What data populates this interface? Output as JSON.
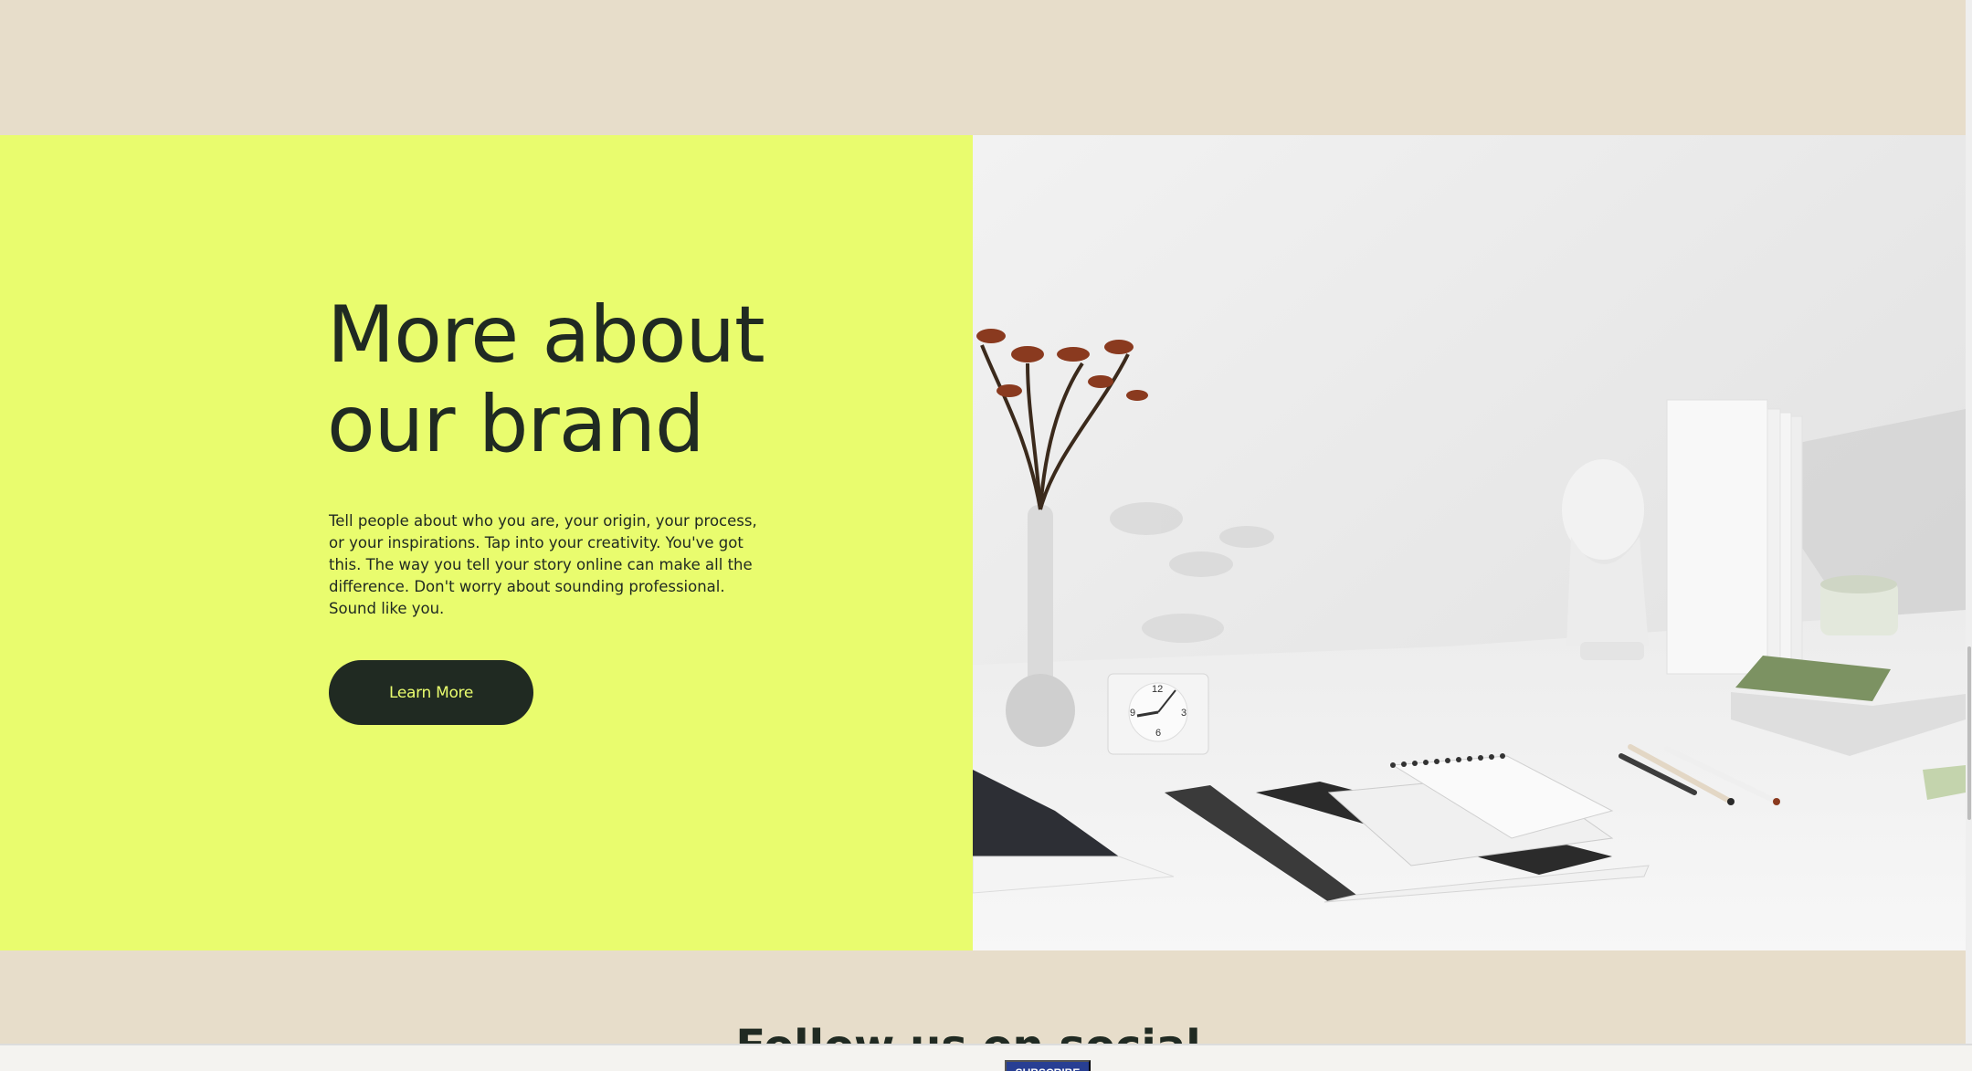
{
  "brand": {
    "heading": "More about our brand",
    "body": "Tell people about who you are, your origin, your process, or your inspirations. Tap into your creativity. You've got this. The way you tell your story online can make all the difference. Don't worry about sounding professional. Sound like you.",
    "button_label": "Learn More",
    "image_icon": "desk-still-life-photo"
  },
  "social": {
    "heading": "Follow us on social"
  },
  "bottom_bar": {
    "subscribe_label": "SUBSCRIBE"
  },
  "colors": {
    "page_background": "#e7ddca",
    "brand_panel": "#e9fc6e",
    "text_dark": "#202a22",
    "button_background": "#202a22",
    "button_text": "#e9fc6e",
    "subscribe_background": "#283f93"
  }
}
